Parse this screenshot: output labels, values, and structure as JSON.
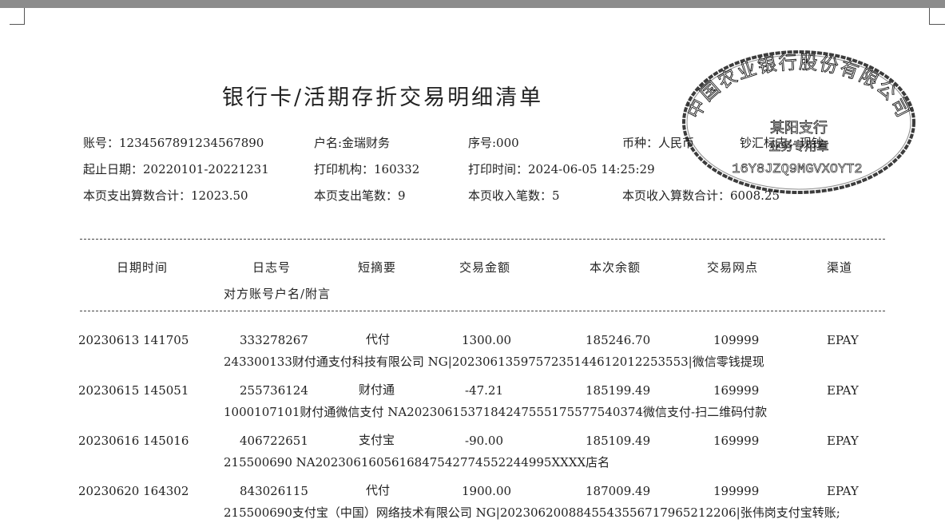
{
  "doc": {
    "title": "银行卡/活期存折交易明细清单",
    "account": "账号：1234567891234567890",
    "holder": "户名:金瑞财务",
    "seq": "序号:000",
    "currency": "币种：人民币",
    "cash_flag": "钞汇标志：现钞",
    "date_range": "起止日期：20220101-20221231",
    "print_org": "打印机构：160332",
    "print_time": "打印时间：2024-06-05 14:25:29",
    "expense_total": "本页支出算数合计：12023.50",
    "expense_count": "本页支出笔数：9",
    "income_count": "本页收入笔数：5",
    "income_total": "本页收入算数合计：6008.25"
  },
  "headers": {
    "datetime": "日期时间",
    "log_no": "日志号",
    "summary": "短摘要",
    "amount": "交易金额",
    "balance": "本次余额",
    "branch": "交易网点",
    "channel": "渠道",
    "counterparty": "对方账号户名/附言"
  },
  "rows": [
    {
      "datetime": "20230613 141705",
      "log_no": "333278267",
      "summary": "代付",
      "amount": "1300.00",
      "balance": "185246.70",
      "branch": "109999",
      "channel": "EPAY",
      "detail": "243300133财付通支付科技有限公司 NG|2023061359757235144612012253553|微信零钱提现"
    },
    {
      "datetime": "20230615 145051",
      "log_no": "255736124",
      "summary": "财付通",
      "amount": "-47.21",
      "balance": "185199.49",
      "branch": "169999",
      "channel": "EPAY",
      "detail": "1000107101财付通微信支付 NA2023061537184247555175577540374微信支付-扫二维码付款"
    },
    {
      "datetime": "20230616 145016",
      "log_no": "406722651",
      "summary": "支付宝",
      "amount": "-90.00",
      "balance": "185109.49",
      "branch": "169999",
      "channel": "EPAY",
      "detail": "215500690 NA2023061605616847542774552244995XXXX店名"
    },
    {
      "datetime": "20230620 164302",
      "log_no": "843026115",
      "summary": "代付",
      "amount": "1900.00",
      "balance": "187009.49",
      "branch": "199999",
      "channel": "EPAY",
      "detail": "215500690支付宝（中国）网络技术有限公司 NG|202306200884554355671796521220​6|张伟岗支付宝转账;"
    }
  ],
  "stamp": {
    "bank_name": "中国农业银行股份有限公司",
    "branch_name": "某阳支行",
    "purpose": "业务专用章",
    "code": "16Y8JZQ9MGVXOYT2"
  }
}
